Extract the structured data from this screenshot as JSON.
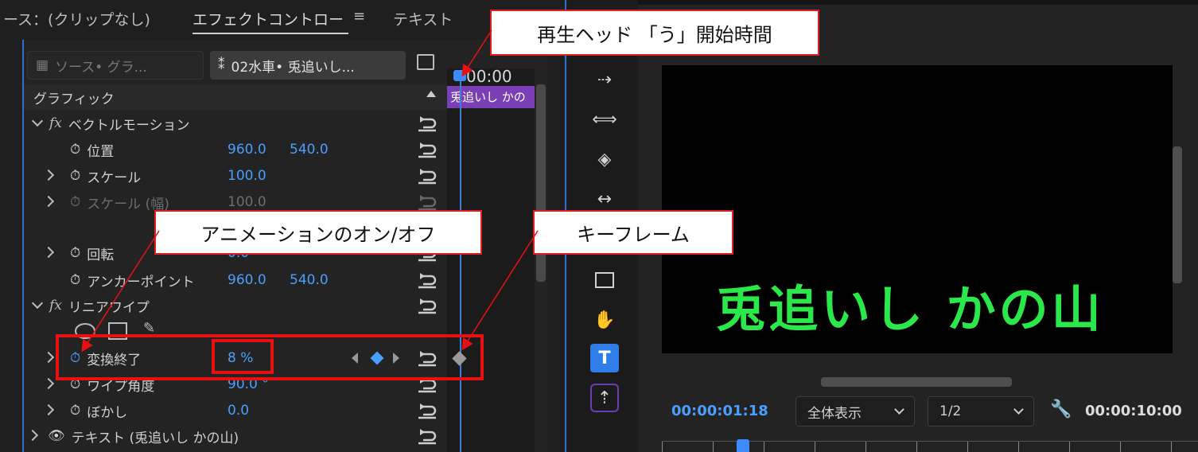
{
  "tabs": {
    "source": "ース：(クリップなし)",
    "effect_controls": "エフェクトコントロー",
    "text": "テキスト"
  },
  "source_selector": {
    "master": "ソース• グラ...",
    "sequence": "02水車• 兎追いし..."
  },
  "timeline": {
    "timecode": "00:00",
    "clip_label": "兎追いし かの"
  },
  "section_header": "グラフィック",
  "vector_motion": {
    "title": "ベクトルモーション",
    "position": {
      "label": "位置",
      "x": "960.0",
      "y": "540.0"
    },
    "scale": {
      "label": "スケール",
      "value": "100.0"
    },
    "scale_width": {
      "label": "スケール (幅)",
      "value": "100.0"
    },
    "rotation": {
      "label": "回転",
      "value": "0.0"
    },
    "anchor": {
      "label": "アンカーポイント",
      "x": "960.0",
      "y": "540.0"
    }
  },
  "linear_wipe": {
    "title": "リニアワイプ",
    "transition_end": {
      "label": "変換終了",
      "value": "8 %"
    },
    "wipe_angle": {
      "label": "ワイプ角度",
      "value": "90.0 °"
    },
    "feather": {
      "label": "ぼかし",
      "value": "0.0"
    }
  },
  "text_layer": {
    "label": "テキスト (兎追いし かの山)"
  },
  "monitor": {
    "video_text": "兎追いし かの山",
    "current_time": "00:00:01:18",
    "zoom": "全体表示",
    "resolution": "1/2",
    "duration": "00:00:10:00"
  },
  "annotations": {
    "playhead": "再生ヘッド 「う」開始時間",
    "animation_toggle": "アニメーションのオン/オフ",
    "keyframe": "キーフレーム"
  },
  "colors": {
    "accent": "#4a9eff",
    "annotation": "#e81010",
    "video_text": "#2be84a",
    "clip": "#7b3fb5"
  }
}
